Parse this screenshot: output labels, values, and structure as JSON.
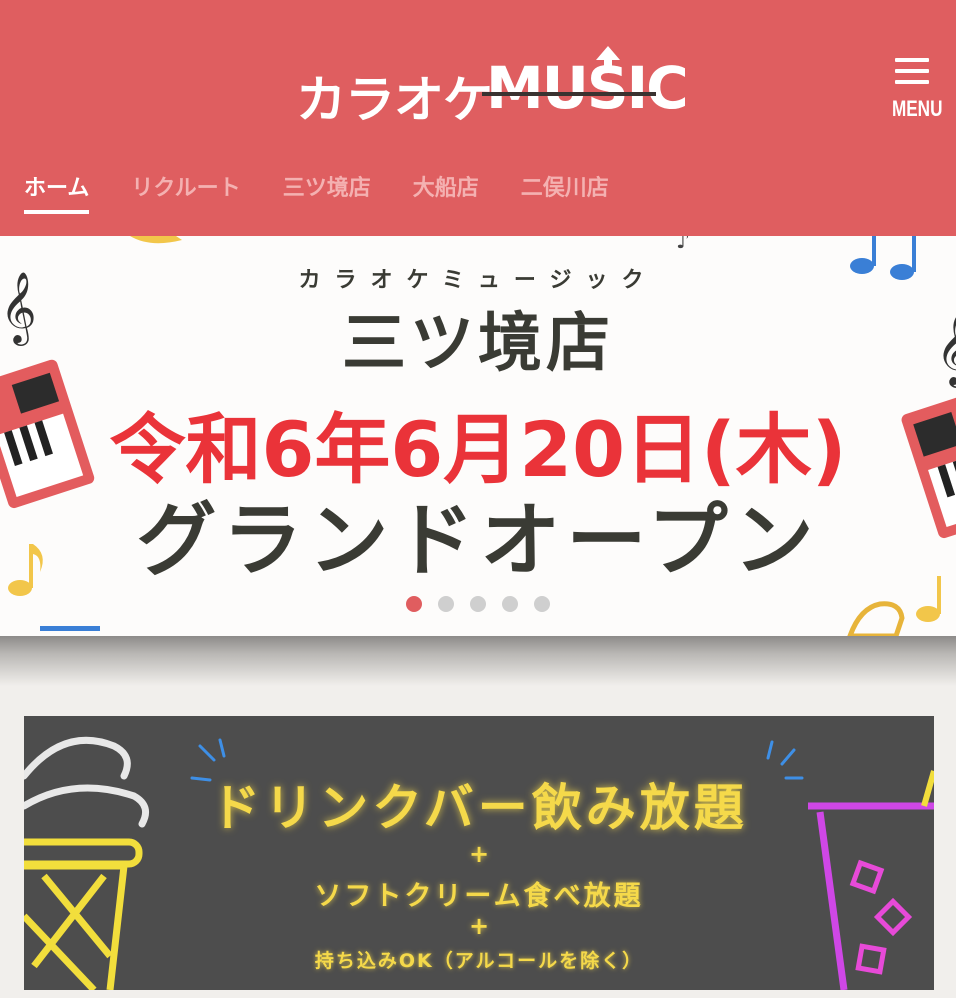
{
  "header": {
    "logo_jp": "カラオケ",
    "logo_en": "MUSIC",
    "menu_label": "MENU",
    "nav": [
      {
        "label": "ホーム",
        "active": true
      },
      {
        "label": "リクルート",
        "active": false
      },
      {
        "label": "三ツ境店",
        "active": false
      },
      {
        "label": "大船店",
        "active": false
      },
      {
        "label": "二俣川店",
        "active": false
      }
    ]
  },
  "hero": {
    "brand_kana": "カラオケミュージック",
    "store_name": "三ツ境店",
    "date": "令和6年6月20日(木)",
    "headline": "グランドオープン",
    "slides_total": 5,
    "active_slide": 1
  },
  "banner": {
    "title": "ドリンクバー飲み放題",
    "plus": "+",
    "subtitle": "ソフトクリーム食べ放題",
    "note": "持ち込みOK（アルコールを除く）"
  },
  "colors": {
    "header_bg": "#df5e60",
    "date_red": "#ea3339",
    "neon_yellow": "#f5d94a",
    "dot_active": "#e05d5f"
  }
}
